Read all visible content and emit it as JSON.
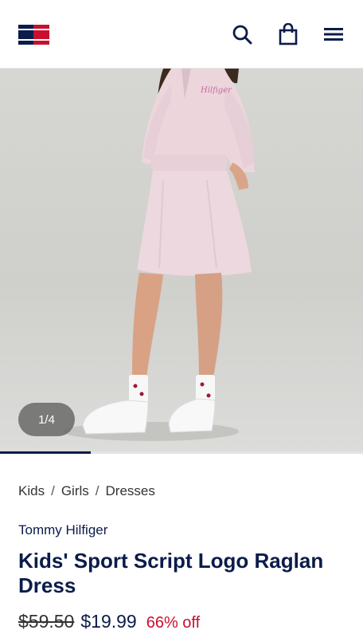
{
  "header": {
    "logo": "tommy-hilfiger-flag",
    "icons": [
      "search-icon",
      "shopping-bag-icon",
      "menu-icon"
    ]
  },
  "gallery": {
    "counter": "1/4",
    "progress": 0.25
  },
  "breadcrumb": {
    "items": [
      "Kids",
      "Girls",
      "Dresses"
    ],
    "separator": "/"
  },
  "product": {
    "brand": "Tommy Hilfiger",
    "title": "Kids' Sport Script Logo Raglan Dress",
    "original_price": "$59.50",
    "sale_price": "$19.99",
    "discount": "66% off"
  },
  "colors": {
    "navy": "#0b1c4a",
    "red": "#c8102e",
    "dress": "#ecd8de"
  }
}
